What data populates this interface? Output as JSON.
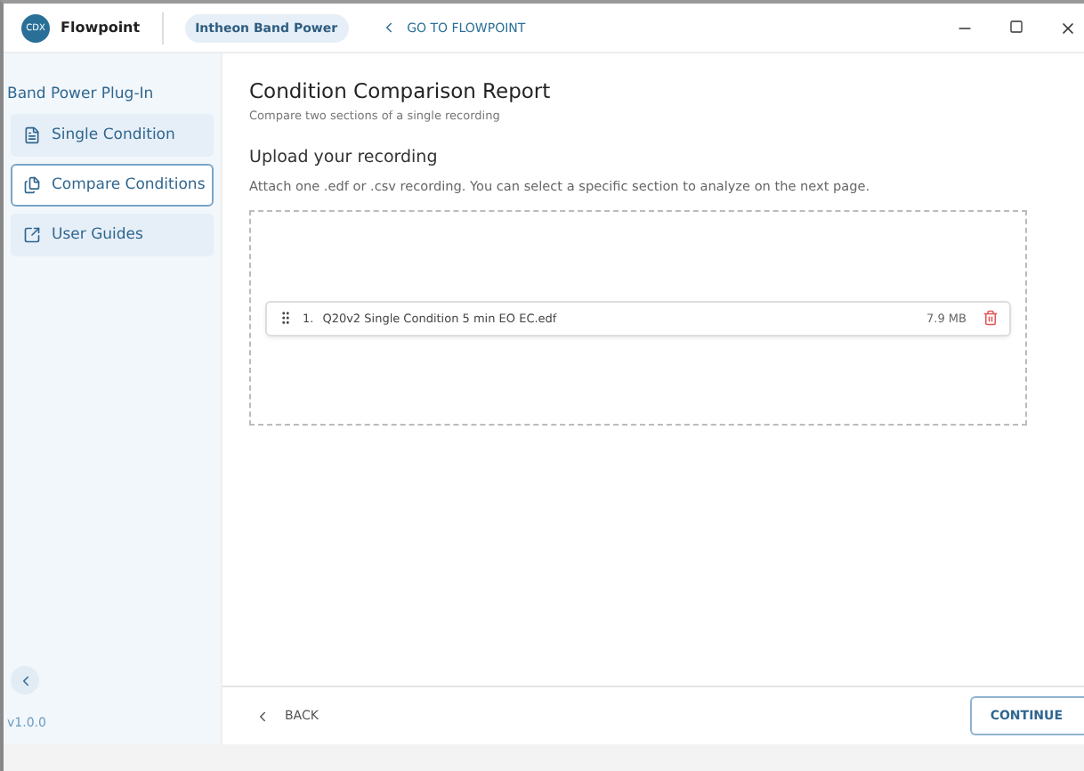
{
  "app": {
    "name": "Flowpoint",
    "logo": "CDX",
    "plugin_badge": "Intheon Band Power",
    "back_link": "GO TO FLOWPOINT"
  },
  "sidebar": {
    "title": "Band Power Plug-In",
    "items": [
      {
        "label": "Single Condition",
        "kind": "document",
        "selected": false
      },
      {
        "label": "Compare Conditions",
        "kind": "documents",
        "selected": true
      },
      {
        "label": "User Guides",
        "kind": "external",
        "selected": false
      }
    ],
    "version": "v1.0.0"
  },
  "page": {
    "title": "Condition Comparison Report",
    "subtitle": "Compare two sections of a single recording",
    "section_title": "Upload your recording",
    "section_text": "Attach one .edf or .csv recording. You can select a specific section to analyze on the next page.",
    "files": [
      {
        "index": "1.",
        "name": "Q20v2 Single Condition 5 min EO EC.edf",
        "size": "7.9 MB"
      }
    ]
  },
  "footer": {
    "back": "BACK",
    "continue": "CONTINUE"
  }
}
